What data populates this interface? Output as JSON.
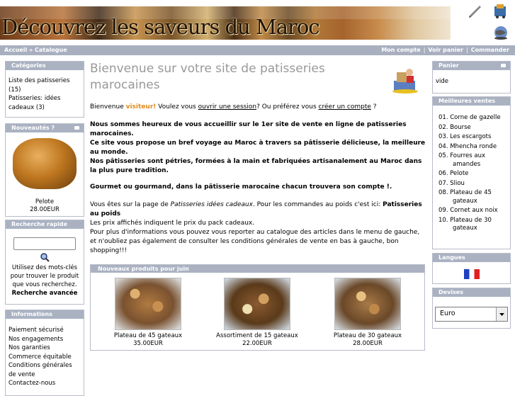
{
  "header": {
    "banner_text": "Découvrez les saveurs du Maroc"
  },
  "nav": {
    "breadcrumb_home": "Accueil",
    "breadcrumb_sep": "»",
    "breadcrumb_current": "Catalogue",
    "account": "Mon compte",
    "cart": "Voir panier",
    "checkout": "Commander",
    "sep": "|"
  },
  "categories": {
    "title": "Catégories",
    "item1": "Liste des patisseries (15)",
    "item2": "Patisseries: idées cadeaux (3)"
  },
  "news": {
    "title": "Nouveautés ?",
    "product": "Pelote",
    "price": "28.00EUR"
  },
  "search": {
    "title": "Recherche rapide",
    "value": "",
    "hint": "Utilisez des mots-clés pour trouver le produit que vous recherchez.",
    "advanced": "Recherche avancée"
  },
  "info": {
    "title": "Informations",
    "items": [
      "Paiement sécurisé",
      "Nos engagements",
      "Nos garanties",
      "Commerce équitable",
      "Conditions générales de vente",
      "Contactez-nous"
    ]
  },
  "main": {
    "title": "Bienvenue sur votre site de patisseries marocaines",
    "welcome_pre": "Bienvenue",
    "welcome_user": "visiteur!",
    "welcome_mid": "Voulez vous",
    "open_session": "ouvrir une session",
    "welcome_or": "? Ou préférez vous",
    "create_account": "créer un compte",
    "welcome_end": "?",
    "bold1": "Nous sommes heureux de vous accueillir sur le 1er site de vente en ligne de patisseries marocaines.",
    "bold2": "Ce site vous propose un bref voyage au Maroc à travers sa pâtisserie délicieuse, la meilleure au monde.",
    "bold3": "Nos pâtisseries sont pétries, formées à la main et fabriquées artisanalement au Maroc dans la plus pure tradition.",
    "bold4": "Gourmet ou gourmand, dans la pâtisserie marocaine chacun trouvera son compte !.",
    "page_pre": "Vous êtes sur la page de",
    "page_name": "Patisseries idées cadeaux",
    "page_mid": ". Pour les commandes au poids c'est ici:",
    "page_link": "Patisseries au poids",
    "prices": "Les prix affichés indiquent le prix du pack cadeaux.",
    "more": "Pour plus d'informations vous pouvez vous reporter au catalogue des articles dans le menu de gauche, et n'oubliez pas également de consulter les conditions générales de vente en bas à gauche, bon shopping!!!"
  },
  "new_products": {
    "title": "Nouveaux produits pour juin",
    "items": [
      {
        "name": "Plateau de 45 gateaux",
        "price": "35.00EUR"
      },
      {
        "name": "Assortiment de 15 gateaux",
        "price": "22.00EUR"
      },
      {
        "name": "Plateau de 30 gateaux",
        "price": "28.00EUR"
      }
    ]
  },
  "cart": {
    "title": "Panier",
    "value": "vide"
  },
  "bestsellers": {
    "title": "Meilleures ventes",
    "items": [
      "01. Corne de gazelle",
      "02. Bourse",
      "03. Les escargots",
      "04. Mhencha ronde",
      "05. Fourres aux amandes",
      "06. Pelote",
      "07. Sliou",
      "08. Plateau de 45 gateaux",
      "09. Cornet aux noix",
      "10. Plateau de 30 gateaux"
    ]
  },
  "languages": {
    "title": "Langues"
  },
  "currencies": {
    "title": "Devises",
    "selected": "Euro"
  },
  "icons": [
    "pen-icon",
    "cart-icon",
    "globe-icon",
    "laptop-person-icon",
    "france-flag-icon",
    "search-magnifier-icon",
    "toggle-arrow-icon"
  ]
}
